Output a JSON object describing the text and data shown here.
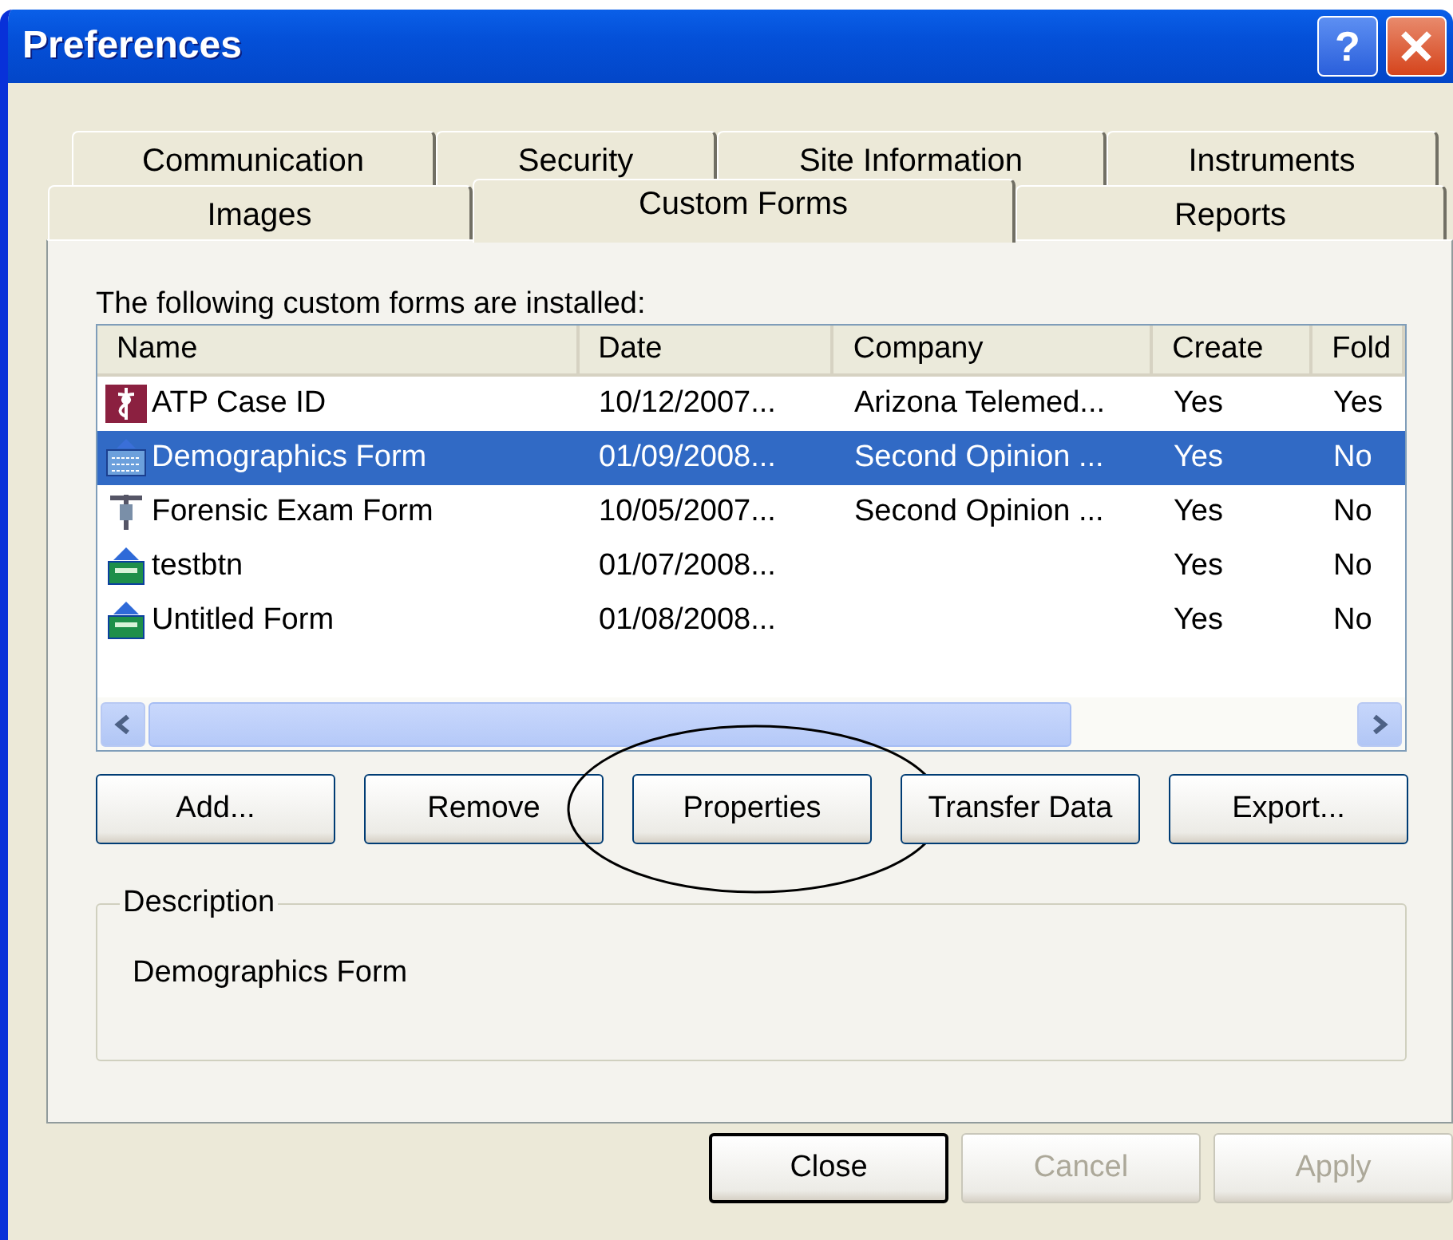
{
  "window": {
    "title": "Preferences",
    "help_glyph": "?"
  },
  "tab_rows": [
    [
      {
        "label": "Communication",
        "selected": false
      },
      {
        "label": "Security",
        "selected": false
      },
      {
        "label": "Site Information",
        "selected": false
      },
      {
        "label": "Instruments",
        "selected": false
      }
    ],
    [
      {
        "label": "Images",
        "selected": false
      },
      {
        "label": "Custom Forms",
        "selected": true
      },
      {
        "label": "Reports",
        "selected": false
      }
    ]
  ],
  "list_label": "The following custom forms are installed:",
  "table": {
    "columns": [
      "Name",
      "Date",
      "Company",
      "Create",
      "Fold"
    ],
    "rows": [
      {
        "kind": "caduceus",
        "selected": false,
        "cells": [
          "ATP Case ID",
          "10/12/2007...",
          "Arizona Telemed...",
          "Yes",
          "Yes"
        ]
      },
      {
        "kind": "keyboard",
        "selected": true,
        "cells": [
          "Demographics Form",
          "01/09/2008...",
          "Second Opinion ...",
          "Yes",
          "No"
        ]
      },
      {
        "kind": "figure",
        "selected": false,
        "cells": [
          "Forensic Exam Form",
          "10/05/2007...",
          "Second Opinion ...",
          "Yes",
          "No"
        ]
      },
      {
        "kind": "form",
        "selected": false,
        "cells": [
          "testbtn",
          "01/07/2008...",
          "",
          "Yes",
          "No"
        ]
      },
      {
        "kind": "form",
        "selected": false,
        "cells": [
          "Untitled Form",
          "01/08/2008...",
          "",
          "Yes",
          "No"
        ]
      }
    ]
  },
  "actions": [
    {
      "label": "Add...",
      "highlighted": false
    },
    {
      "label": "Remove",
      "highlighted": false
    },
    {
      "label": "Properties",
      "highlighted": true
    },
    {
      "label": "Transfer Data",
      "highlighted": false
    },
    {
      "label": "Export...",
      "highlighted": false
    }
  ],
  "description": {
    "legend": "Description",
    "text": "Demographics Form"
  },
  "footer_buttons": [
    {
      "label": "Close",
      "default": true,
      "disabled": false
    },
    {
      "label": "Cancel",
      "default": false,
      "disabled": true
    },
    {
      "label": "Apply",
      "default": false,
      "disabled": true
    }
  ]
}
